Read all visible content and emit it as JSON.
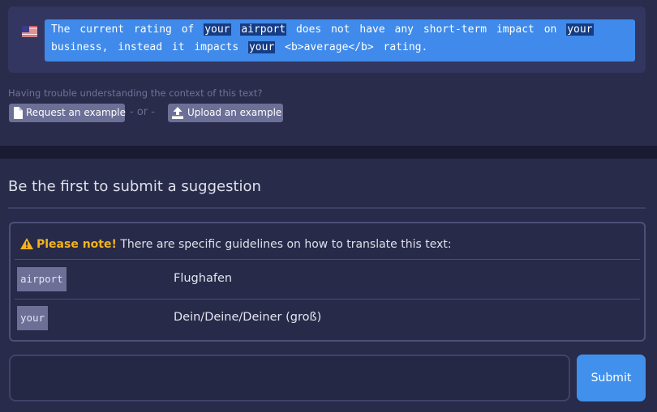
{
  "source": {
    "flag_icon": "us-flag-icon",
    "segments": [
      {
        "text": "The current rating of ",
        "highlight": false
      },
      {
        "text": "your",
        "highlight": true
      },
      {
        "text": " ",
        "highlight": false
      },
      {
        "text": "airport",
        "highlight": true
      },
      {
        "text": " does not have any short-term impact on ",
        "highlight": false
      },
      {
        "text": "your",
        "highlight": true
      },
      {
        "text": " business, instead it impacts ",
        "highlight": false
      },
      {
        "text": "your",
        "highlight": true
      },
      {
        "text": " <b>average</b> rating.",
        "highlight": false
      }
    ]
  },
  "context": {
    "question": "Having trouble understanding the context of this text?",
    "request_label": "Request an example",
    "separator": "- or -",
    "upload_label": "Upload an example"
  },
  "suggestions": {
    "heading": "Be the first to submit a suggestion"
  },
  "guidelines": {
    "note_strong": "Please note!",
    "note_text": " There are specific guidelines on how to translate this text:",
    "terms": [
      {
        "term": "airport",
        "translation": "Flughafen"
      },
      {
        "term": "your",
        "translation": "Dein/Deine/Deiner (groß)"
      }
    ]
  },
  "form": {
    "input_value": "",
    "submit_label": "Submit"
  },
  "colors": {
    "accent": "#4191ec",
    "highlight": "#153c85",
    "warning": "#f3b31d"
  }
}
